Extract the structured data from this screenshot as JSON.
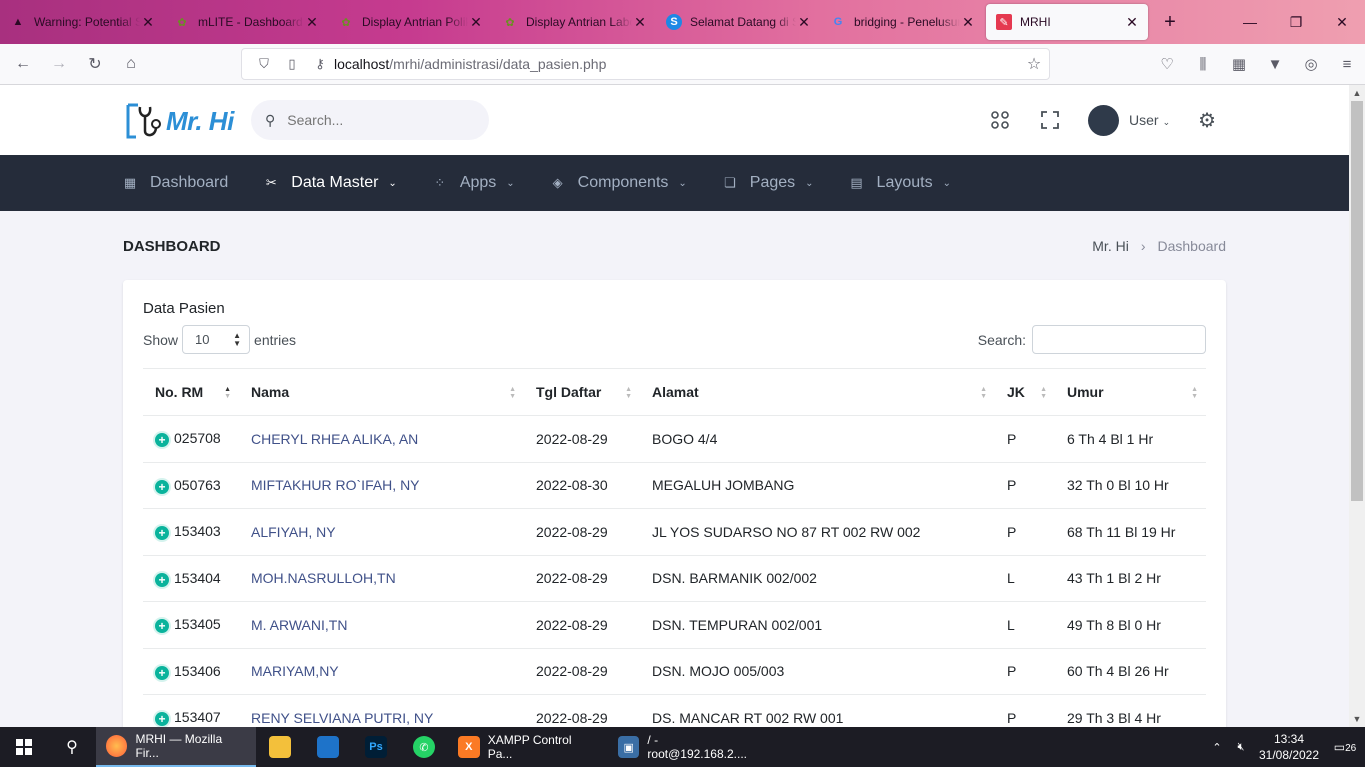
{
  "browser": {
    "tabs": [
      {
        "title": "Warning: Potential Security Risk Ahead",
        "icon": "warning-icon",
        "active": false
      },
      {
        "title": "mLITE - Dashboard",
        "icon": "mlite-icon",
        "active": false
      },
      {
        "title": "Display Antrian Poliklinik",
        "icon": "mlite-icon",
        "active": false
      },
      {
        "title": "Display Antrian Laboratorium",
        "icon": "mlite-icon",
        "active": false
      },
      {
        "title": "Selamat Datang di SIMRS",
        "icon": "s-icon",
        "active": false
      },
      {
        "title": "bridging - Penelusuran Google",
        "icon": "google-icon",
        "active": false
      },
      {
        "title": "MRHI",
        "icon": "mrhi-icon",
        "active": true
      }
    ],
    "url_host": "localhost",
    "url_path": "/mrhi/administrasi/data_pasien.php"
  },
  "header": {
    "logo_text": "Mr. Hi",
    "search_placeholder": "Search...",
    "user_name": "User"
  },
  "menu": {
    "items": [
      {
        "label": "Dashboard",
        "icon": "dashboard-icon",
        "has_caret": false,
        "active": false
      },
      {
        "label": "Data Master",
        "icon": "data-master-icon",
        "has_caret": true,
        "active": true
      },
      {
        "label": "Apps",
        "icon": "apps-icon",
        "has_caret": true,
        "active": false
      },
      {
        "label": "Components",
        "icon": "layers-icon",
        "has_caret": true,
        "active": false
      },
      {
        "label": "Pages",
        "icon": "pages-icon",
        "has_caret": true,
        "active": false
      },
      {
        "label": "Layouts",
        "icon": "layouts-icon",
        "has_caret": true,
        "active": false
      }
    ]
  },
  "page": {
    "title": "DASHBOARD",
    "breadcrumb": [
      "Mr. Hi",
      "Dashboard"
    ]
  },
  "table_card": {
    "title": "Data Pasien",
    "show_label": "Show",
    "entries_value": "10",
    "entries_label": "entries",
    "search_label": "Search:",
    "columns": [
      "No. RM",
      "Nama",
      "Tgl Daftar",
      "Alamat",
      "JK",
      "Umur"
    ],
    "rows": [
      {
        "no_rm": "025708",
        "nama": "CHERYL RHEA ALIKA, AN",
        "tgl": "2022-08-29",
        "alamat": "BOGO 4/4",
        "jk": "P",
        "umur": "6 Th 4 Bl 1 Hr"
      },
      {
        "no_rm": "050763",
        "nama": "MIFTAKHUR RO`IFAH, NY",
        "tgl": "2022-08-30",
        "alamat": "MEGALUH JOMBANG",
        "jk": "P",
        "umur": "32 Th 0 Bl 10 Hr"
      },
      {
        "no_rm": "153403",
        "nama": "ALFIYAH, NY",
        "tgl": "2022-08-29",
        "alamat": "JL YOS SUDARSO NO 87 RT 002 RW 002",
        "jk": "P",
        "umur": "68 Th 11 Bl 19 Hr"
      },
      {
        "no_rm": "153404",
        "nama": "MOH.NASRULLOH,TN",
        "tgl": "2022-08-29",
        "alamat": "DSN. BARMANIK 002/002",
        "jk": "L",
        "umur": "43 Th 1 Bl 2 Hr"
      },
      {
        "no_rm": "153405",
        "nama": "M. ARWANI,TN",
        "tgl": "2022-08-29",
        "alamat": "DSN. TEMPURAN 002/001",
        "jk": "L",
        "umur": "49 Th 8 Bl 0 Hr"
      },
      {
        "no_rm": "153406",
        "nama": "MARIYAM,NY",
        "tgl": "2022-08-29",
        "alamat": "DSN. MOJO 005/003",
        "jk": "P",
        "umur": "60 Th 4 Bl 26 Hr"
      },
      {
        "no_rm": "153407",
        "nama": "RENY SELVIANA PUTRI, NY",
        "tgl": "2022-08-29",
        "alamat": "DS. MANCAR RT 002 RW 001",
        "jk": "P",
        "umur": "29 Th 3 Bl 4 Hr"
      }
    ]
  },
  "taskbar": {
    "apps": [
      {
        "label": "MRHI — Mozilla Fir...",
        "icon": "firefox-icon",
        "active": true
      },
      {
        "label": "",
        "icon": "file-explorer-icon",
        "active": false
      },
      {
        "label": "",
        "icon": "app-icon",
        "active": false
      },
      {
        "label": "",
        "icon": "photoshop-icon",
        "active": false
      },
      {
        "label": "",
        "icon": "whatsapp-icon",
        "active": false
      },
      {
        "label": "XAMPP Control Pa...",
        "icon": "xampp-icon",
        "active": false
      },
      {
        "label": "/ - root@192.168.2....",
        "icon": "terminal-icon",
        "active": false
      }
    ],
    "time": "13:34",
    "date": "31/08/2022",
    "notifications": "26"
  },
  "colors": {
    "menubar_bg": "#252c3a",
    "link": "#405189",
    "expand": "#0ab39c"
  }
}
